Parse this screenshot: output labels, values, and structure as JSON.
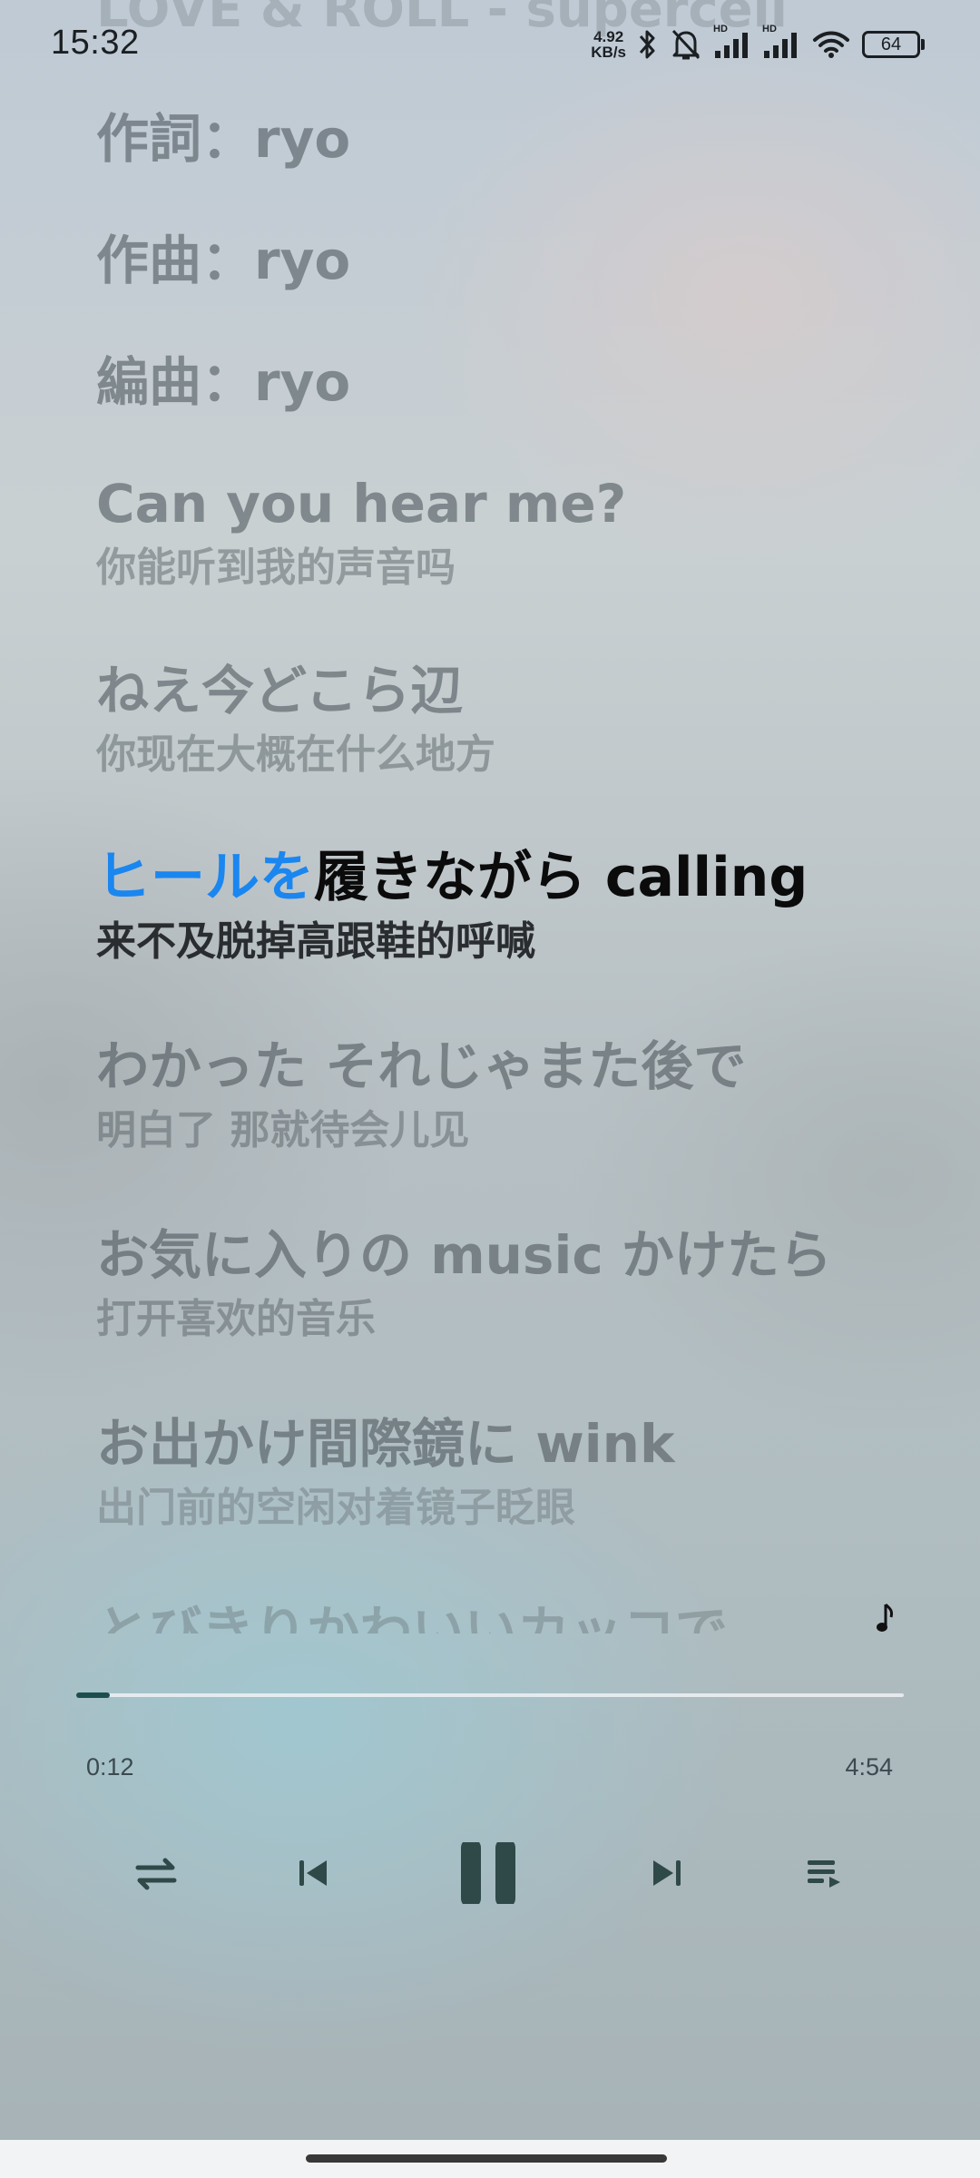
{
  "status_bar": {
    "time": "15:32",
    "net_speed_value": "4.92",
    "net_speed_unit": "KB/s",
    "hd_label_1": "HD",
    "hd_label_2": "HD",
    "battery": "64"
  },
  "lyrics": {
    "faded_title": "LOVE & ROLL - supercell",
    "lines": [
      {
        "main": "作詞：ryo"
      },
      {
        "main": "作曲：ryo"
      },
      {
        "main": "編曲：ryo"
      },
      {
        "main": "Can you hear me?",
        "translation": "你能听到我的声音吗"
      },
      {
        "main": "ねえ今どこら辺",
        "translation": "你现在大概在什么地方"
      },
      {
        "main_highlighted": "ヒールを",
        "main_rest": "履きながら calling",
        "translation": "来不及脱掉高跟鞋的呼喊"
      },
      {
        "main": "わかった それじゃまた後で",
        "translation": "明白了 那就待会儿见"
      },
      {
        "main": "お気に入りの music かけたら",
        "translation": "打开喜欢的音乐"
      },
      {
        "main": "お出かけ間際鏡に wink",
        "translation": "出门前的空闲对着镜子眨眼"
      },
      {
        "main": "とびきりかわいいカッコで"
      }
    ]
  },
  "player": {
    "progress_fraction": 0.041,
    "time_current": "0:12",
    "time_total": "4:54"
  },
  "colors": {
    "accent_highlight": "#1a86f0",
    "progress_fill": "#1d4e4e",
    "controls": "#2f4848"
  }
}
